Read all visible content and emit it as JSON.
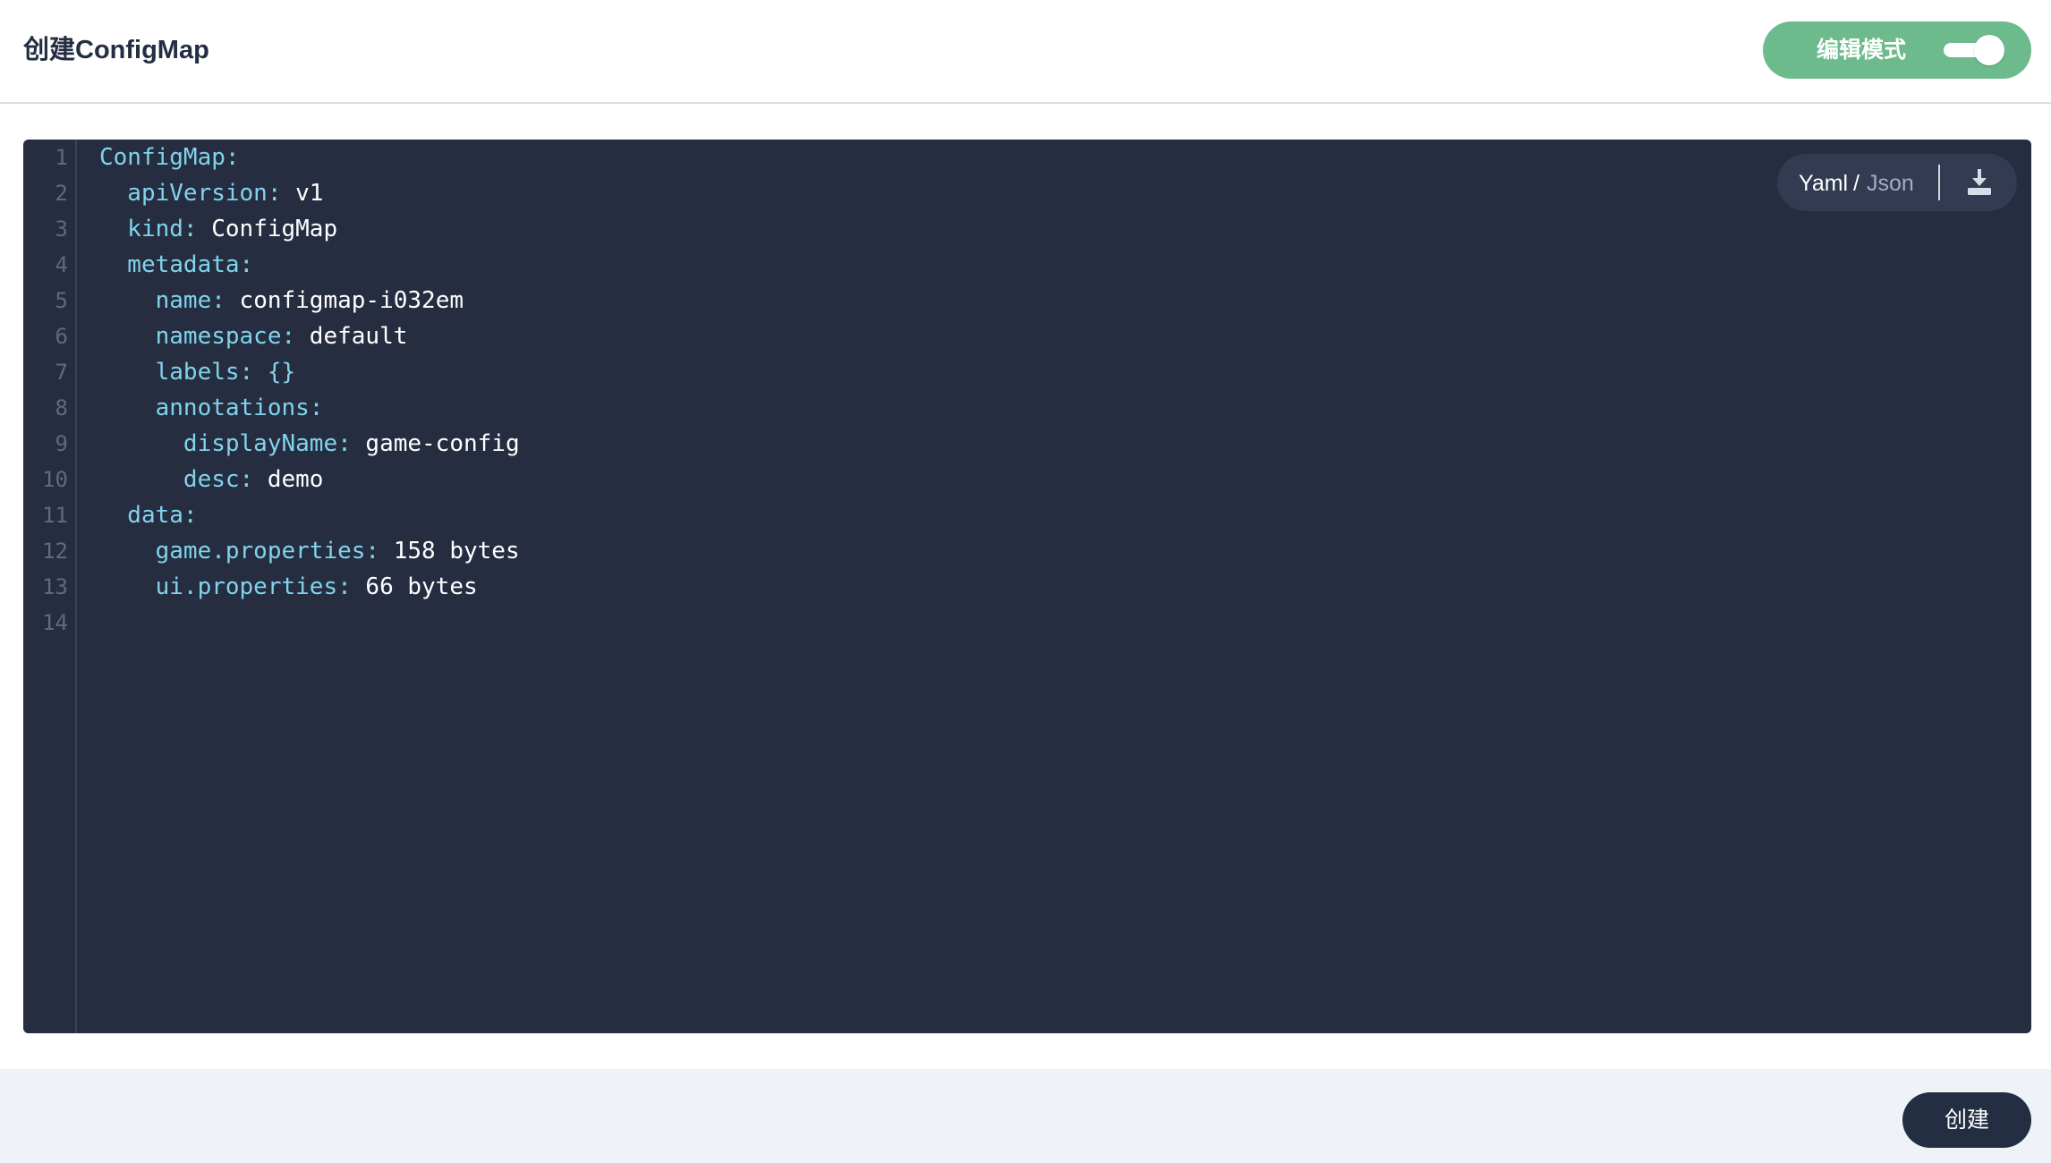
{
  "header": {
    "title": "创建ConfigMap",
    "mode_toggle": {
      "label": "编辑模式",
      "enabled": true
    }
  },
  "editor": {
    "format": {
      "yaml_label": "Yaml",
      "separator": "/",
      "json_label": "Json",
      "active": "Yaml"
    },
    "download_icon": "download-icon",
    "line_numbers": [
      "1",
      "2",
      "3",
      "4",
      "5",
      "6",
      "7",
      "8",
      "9",
      "10",
      "11",
      "12",
      "13",
      "14"
    ],
    "lines": [
      {
        "key": "ConfigMap:",
        "value": ""
      },
      {
        "key": "  apiVersion:",
        "value": " v1"
      },
      {
        "key": "  kind:",
        "value": " ConfigMap"
      },
      {
        "key": "  metadata:",
        "value": ""
      },
      {
        "key": "    name:",
        "value": " configmap-i032em"
      },
      {
        "key": "    namespace:",
        "value": " default"
      },
      {
        "key": "    labels: {}",
        "value": ""
      },
      {
        "key": "    annotations:",
        "value": ""
      },
      {
        "key": "      displayName:",
        "value": " game-config"
      },
      {
        "key": "      desc:",
        "value": " demo"
      },
      {
        "key": "  data:",
        "value": ""
      },
      {
        "key": "    game.properties:",
        "value": " 158 bytes"
      },
      {
        "key": "    ui.properties:",
        "value": " 66 bytes"
      },
      {
        "key": "",
        "value": ""
      }
    ]
  },
  "footer": {
    "create_label": "创建"
  },
  "colors": {
    "toggle_bg": "#6dbb8d",
    "editor_bg": "#262d40",
    "code_key": "#7fd4ec",
    "button_dark": "#242e42",
    "footer_bg": "#eff3f8"
  }
}
